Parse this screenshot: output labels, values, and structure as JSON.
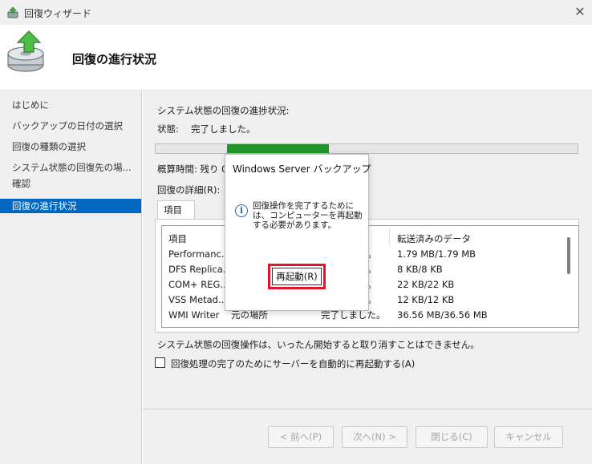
{
  "window": {
    "title": "回復ウィザード",
    "close_glyph": "✕"
  },
  "header": {
    "title": "回復の進行状況"
  },
  "sidebar": {
    "items": [
      {
        "label": "はじめに",
        "active": false
      },
      {
        "label": "バックアップの日付の選択",
        "active": false
      },
      {
        "label": "回復の種類の選択",
        "active": false
      },
      {
        "label": "システム状態の回復先の場...",
        "active": false
      },
      {
        "label": "確認",
        "active": false
      },
      {
        "label": "回復の進行状況",
        "active": true
      }
    ]
  },
  "main": {
    "progress_heading": "システム状態の回復の進捗状況:",
    "status_label": "状態:",
    "status_value": "完了しました。",
    "elapsed_label": "概算時間: 残り 0",
    "details_label": "回復の詳細(R):",
    "tab_label": "項目",
    "columns": [
      "項目",
      "転送済みのデータ"
    ],
    "rows": [
      {
        "item": "Performanc...",
        "status": "。",
        "transferred": "1.79 MB/1.79 MB"
      },
      {
        "item": "DFS Replica...",
        "status": "。",
        "transferred": "8 KB/8 KB"
      },
      {
        "item": "COM+ REG...",
        "status": "。",
        "transferred": "22 KB/22 KB"
      },
      {
        "item": "VSS Metad...",
        "status": "。",
        "transferred": "12 KB/12 KB"
      },
      {
        "item": "WMI Writer",
        "location": "元の場所",
        "status": "完了しました。",
        "transferred": "36.56 MB/36.56 MB"
      }
    ],
    "warning": "システム状態の回復操作は、いったん開始すると取り消すことはできません。",
    "auto_restart_label": "回復処理の完了のためにサーバーを自動的に再起動する(A)",
    "auto_restart_checked": false
  },
  "buttons": {
    "prev": "< 前へ(P)",
    "next": "次へ(N) >",
    "close": "閉じる(C)",
    "cancel": "キャンセル"
  },
  "dialog": {
    "title": "Windows Server バックアップ",
    "message": "回復操作を完了するためには、コンピューターを再起動する必要があります。",
    "info_glyph": "i",
    "restart_button": "再起動(R)"
  },
  "colors": {
    "selection": "#0067c0",
    "progress_fill": "#23962b",
    "highlight_border": "#e8112d",
    "info_icon": "#2a64b0"
  }
}
